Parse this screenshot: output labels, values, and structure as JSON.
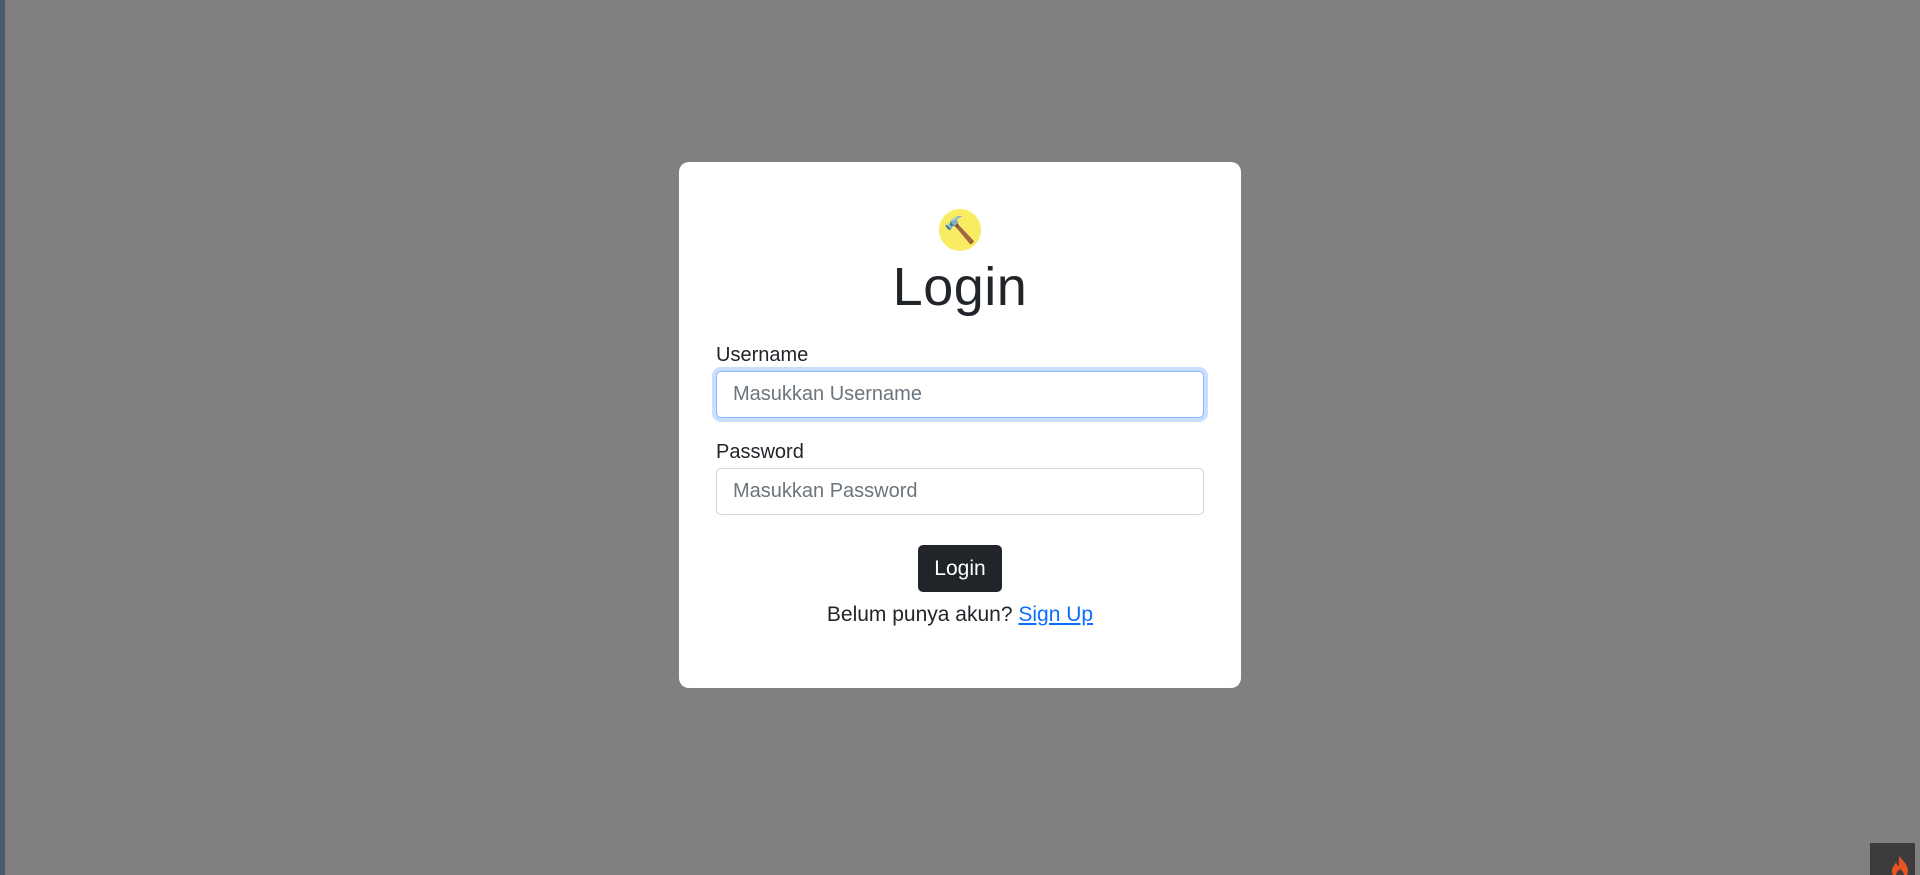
{
  "login_card": {
    "logo_icon": "hammer-icon",
    "title": "Login",
    "username": {
      "label": "Username",
      "placeholder": "Masukkan Username",
      "value": ""
    },
    "password": {
      "label": "Password",
      "placeholder": "Masukkan Password",
      "value": ""
    },
    "submit_label": "Login",
    "signup_prompt": "Belum punya akun?",
    "signup_link": "Sign Up"
  },
  "corner_widget": {
    "icon": "flame-icon"
  },
  "colors": {
    "background": "#808080",
    "card": "#ffffff",
    "button": "#212529",
    "link": "#0d6efd",
    "logo_circle": "#f9ec63",
    "flame": "#e8531f"
  }
}
